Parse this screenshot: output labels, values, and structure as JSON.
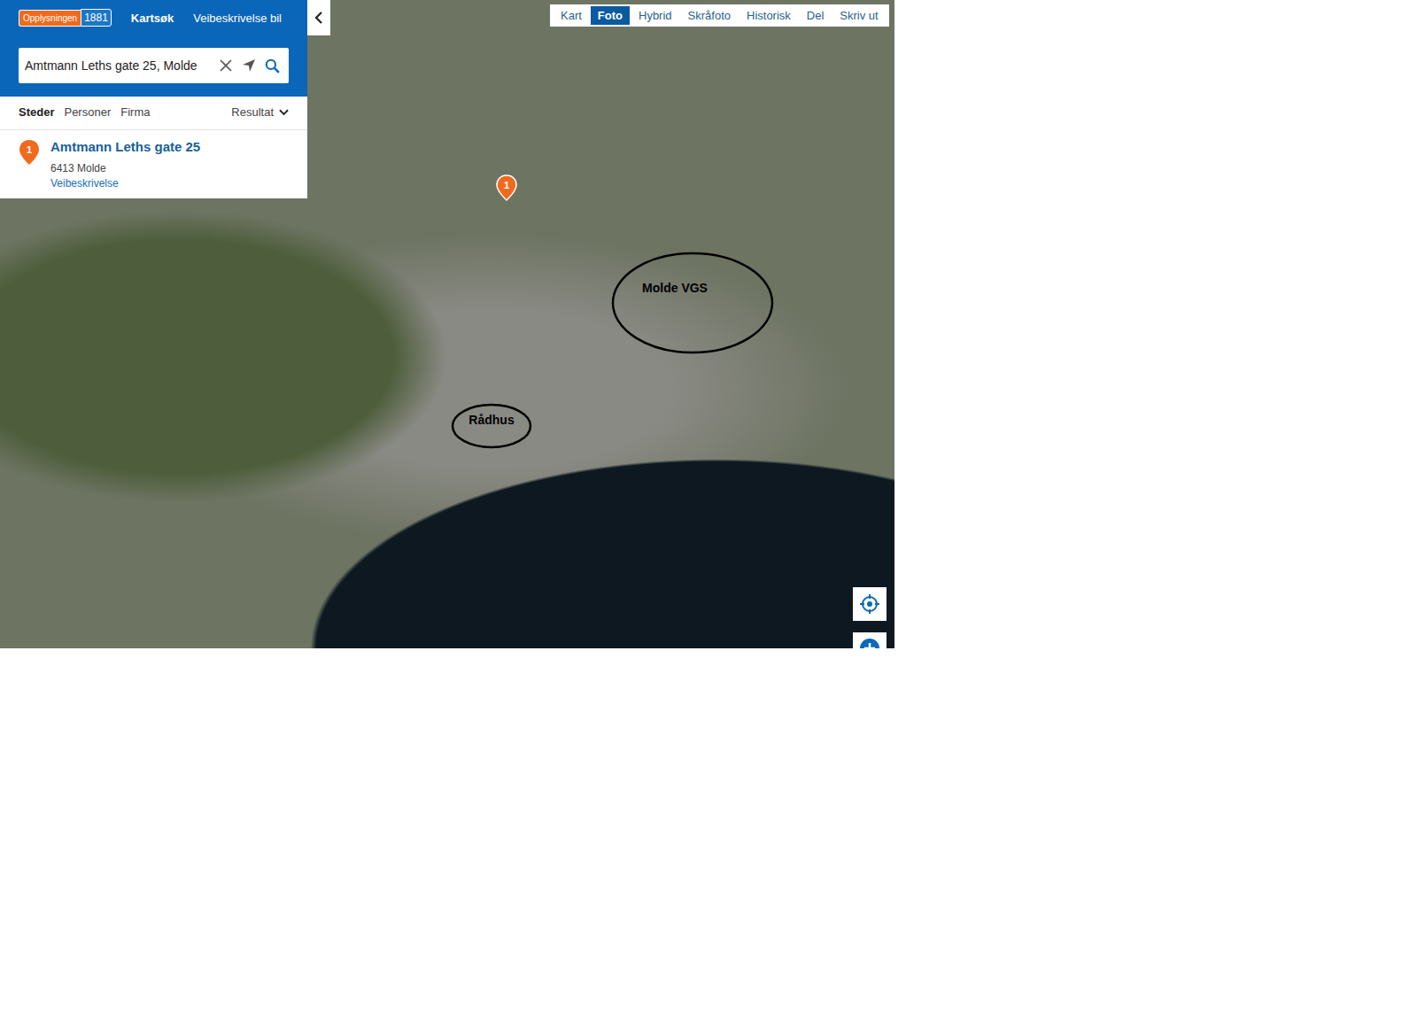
{
  "header": {
    "logo": "Opplysningen",
    "logo_number": "1881",
    "nav": [
      {
        "label": "Kartsøk",
        "selected": true
      },
      {
        "label": "Veibeskrivelse bil",
        "selected": false
      }
    ]
  },
  "search": {
    "value": "Amtmann Leths gate 25, Molde"
  },
  "filter_tabs": [
    {
      "label": "Steder",
      "selected": true
    },
    {
      "label": "Personer",
      "selected": false
    },
    {
      "label": "Firma",
      "selected": false
    }
  ],
  "sort": {
    "label": "Resultat"
  },
  "results": [
    {
      "marker": "1",
      "title": "Amtmann Leths gate 25",
      "address": "6413 Molde",
      "link": "Veibeskrivelse"
    }
  ],
  "map_types": [
    {
      "label": "Kart",
      "selected": false
    },
    {
      "label": "Foto",
      "selected": true
    },
    {
      "label": "Hybrid",
      "selected": false
    },
    {
      "label": "Skråfoto",
      "selected": false
    },
    {
      "label": "Historisk",
      "selected": false
    }
  ],
  "map_actions": [
    "Del",
    "Skriv ut"
  ],
  "map_pins": [
    {
      "label": "1"
    }
  ],
  "annotations": [
    {
      "label": "Molde VGS"
    },
    {
      "label": "Rådhus"
    }
  ]
}
